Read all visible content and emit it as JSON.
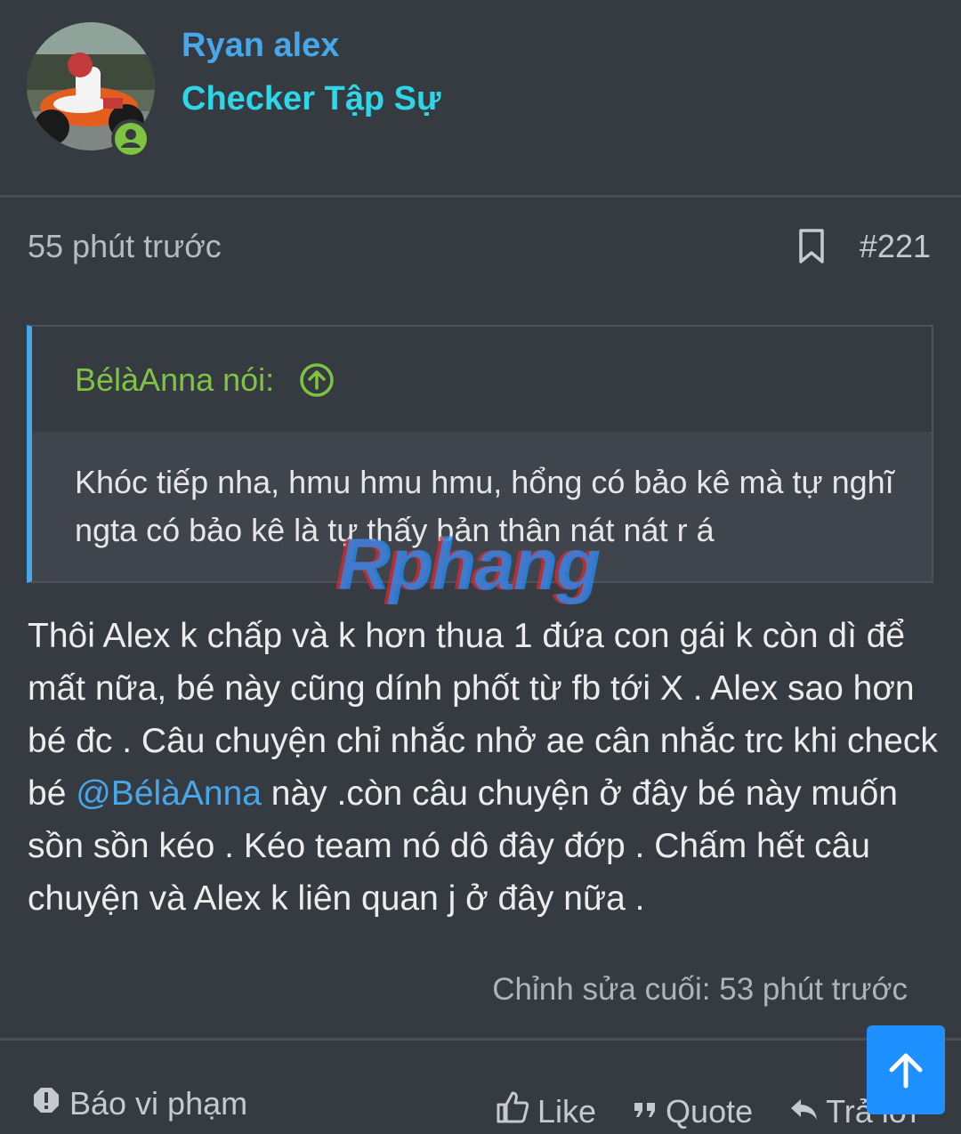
{
  "user": {
    "name": "Ryan alex",
    "title": "Checker Tập Sự",
    "avatar_icon": "avatar-motorbike",
    "online_icon": "user-online-icon"
  },
  "post": {
    "time": "55 phút trước",
    "number": "#221",
    "quote": {
      "author": "BélàAnna nói:",
      "text": "Khóc tiếp nha, hmu hmu hmu, hổng có bảo kê mà tự nghĩ ngta có bảo kê là tự thấy bản thân nát nát r á"
    },
    "body_before": "Thôi Alex k chấp và k hơn thua 1 đứa con gái k còn dì để mất nữa, bé này cũng dính phốt từ fb tới X . Alex sao hơn bé đc . Câu chuyện chỉ nhắc nhở ae cân nhắc trc khi check bé ",
    "mention": "@BélàAnna",
    "body_after": " này .còn câu chuyện ở đây bé này muốn sồn sồn kéo . Kéo team nó dô đây đớp . Chấm hết câu chuyện và Alex k liên quan j ở đây nữa .",
    "edited": "Chỉnh sửa cuối: 53 phút trước"
  },
  "watermark": "Rphang",
  "actions": {
    "report": "Báo vi phạm",
    "like": "Like",
    "quote": "Quote",
    "reply": "Trả lời"
  },
  "colors": {
    "background": "#363a41",
    "username": "#47a7eb",
    "usertitle": "#2fd6e8",
    "quote_author": "#7ec342",
    "accent": "#1e90ff"
  }
}
